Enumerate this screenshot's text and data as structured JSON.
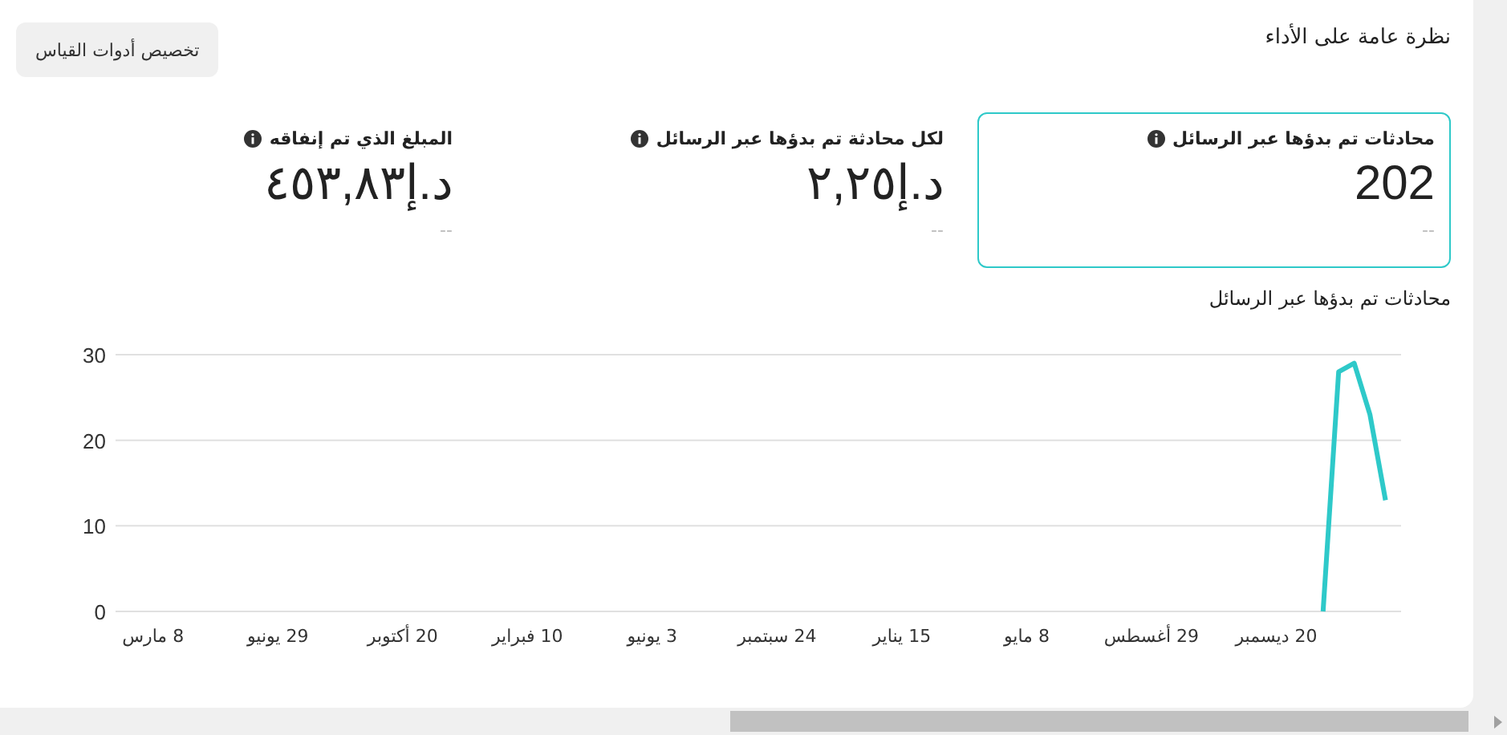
{
  "header": {
    "title": "نظرة عامة على الأداء",
    "customize_button": "تخصيص أدوات القياس"
  },
  "metrics": [
    {
      "label": "محادثات تم بدؤها عبر الرسائل",
      "value": "202",
      "change": "--",
      "selected": true
    },
    {
      "label": "لكل محادثة تم بدؤها عبر الرسائل",
      "value": "د.إ٢,٢٥",
      "change": "--",
      "selected": false
    },
    {
      "label": "المبلغ الذي تم إنفاقه",
      "value": "د.إ٤٥٣,٨٣",
      "change": "--",
      "selected": false
    }
  ],
  "chart": {
    "title": "محادثات تم بدؤها عبر الرسائل",
    "chart_data": {
      "type": "line",
      "categories": [
        "8 مارس",
        null,
        null,
        null,
        null,
        null,
        null,
        null,
        "29 يونيو",
        null,
        null,
        null,
        null,
        null,
        null,
        null,
        "20 أكتوبر",
        null,
        null,
        null,
        null,
        null,
        null,
        null,
        "10 فبراير",
        null,
        null,
        null,
        null,
        null,
        null,
        null,
        "3 يونيو",
        null,
        null,
        null,
        null,
        null,
        null,
        null,
        "24 سبتمبر",
        null,
        null,
        null,
        null,
        null,
        null,
        null,
        "15 يناير",
        null,
        null,
        null,
        null,
        null,
        null,
        null,
        "8 مايو",
        null,
        null,
        null,
        null,
        null,
        null,
        null,
        "29 أغسطس",
        null,
        null,
        null,
        null,
        null,
        null,
        null,
        "20 ديسمبر",
        null,
        null,
        null,
        null,
        null,
        null,
        null
      ],
      "series": [
        {
          "color": "#2ec9c9",
          "values": [
            null,
            null,
            null,
            null,
            null,
            null,
            null,
            null,
            null,
            null,
            null,
            null,
            null,
            null,
            null,
            null,
            null,
            null,
            null,
            null,
            null,
            null,
            null,
            null,
            null,
            null,
            null,
            null,
            null,
            null,
            null,
            null,
            null,
            null,
            null,
            null,
            null,
            null,
            null,
            null,
            null,
            null,
            null,
            null,
            null,
            null,
            null,
            null,
            null,
            null,
            null,
            null,
            null,
            null,
            null,
            null,
            null,
            null,
            null,
            null,
            null,
            null,
            null,
            null,
            null,
            null,
            null,
            null,
            null,
            null,
            null,
            null,
            null,
            null,
            null,
            0,
            28,
            29,
            23,
            13
          ]
        }
      ],
      "ylim": [
        0,
        30
      ],
      "yticks": [
        0,
        10,
        20,
        30
      ]
    }
  }
}
